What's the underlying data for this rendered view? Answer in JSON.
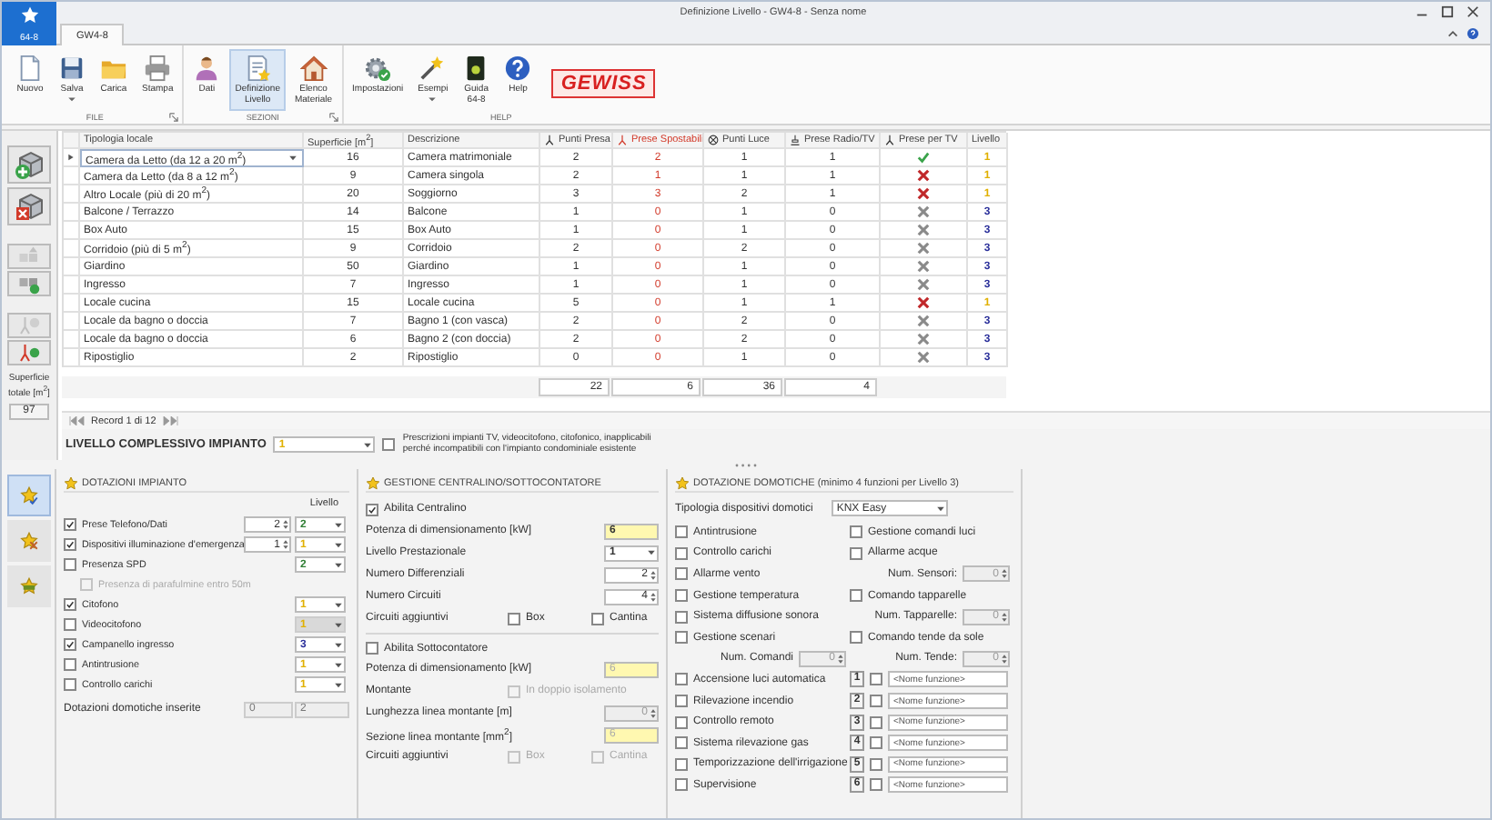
{
  "window": {
    "title": "Definizione Livello - GW4-8 - Senza nome"
  },
  "app_button": {
    "label": "64-8"
  },
  "tabs": [
    {
      "label": "GW4-8",
      "selected": true
    }
  ],
  "ribbon": [
    {
      "label": "FILE",
      "launcher": true,
      "buttons": [
        {
          "label": "Nuovo",
          "dropdown": false,
          "selected": false
        },
        {
          "label": "Salva",
          "dropdown": true,
          "selected": false
        },
        {
          "label": "Carica",
          "dropdown": false,
          "selected": false
        },
        {
          "label": "Stampa",
          "dropdown": false,
          "selected": false
        }
      ]
    },
    {
      "label": "SEZIONI",
      "launcher": true,
      "buttons": [
        {
          "label": "Dati",
          "dropdown": false,
          "selected": false
        },
        {
          "label": "Definizione Livello",
          "dropdown": false,
          "selected": true
        },
        {
          "label": "Elenco Materiale",
          "dropdown": false,
          "selected": false
        }
      ]
    },
    {
      "label": "HELP",
      "launcher": false,
      "logo": "GEWISS",
      "buttons": [
        {
          "label": "Impostazioni",
          "dropdown": false,
          "selected": false
        },
        {
          "label": "Esempi",
          "dropdown": true,
          "selected": false
        },
        {
          "label": "Guida 64-8",
          "dropdown": false,
          "selected": false
        },
        {
          "label": "Help",
          "dropdown": false,
          "selected": false
        }
      ]
    }
  ],
  "toolbar": [
    {
      "disabled": false
    },
    {
      "disabled": false
    },
    {
      "disabled": true
    },
    {
      "disabled": false
    },
    {
      "disabled": true
    },
    {
      "disabled": false
    }
  ],
  "surface_total": {
    "label": "Superficie totale [m$^{2}$]",
    "value": "97"
  },
  "table": {
    "columns": [
      {
        "label": "Tipologia locale"
      },
      {
        "label": "Superficie [m$^{2}$]"
      },
      {
        "label": "Descrizione"
      },
      {
        "label": "Punti Presa"
      },
      {
        "label": "Prese Spostabili"
      },
      {
        "label": "Punti Luce"
      },
      {
        "label": "Prese Radio/TV"
      },
      {
        "label": "Prese per TV"
      },
      {
        "label": "Livello"
      }
    ],
    "rows": [
      {
        "selected": true,
        "tipologia": "Camera da Letto (da 12 a 20 m$^{2}$)",
        "superficie": "16",
        "descrizione": "Camera matrimoniale",
        "punti_presa": "2",
        "prese_spostabili": "2",
        "punti_luce": "1",
        "prese_radio_tv": "1",
        "tv_applicable": true,
        "tv_ok": true,
        "livello": "1",
        "color": "#e0b000"
      },
      {
        "selected": false,
        "tipologia": "Camera da Letto (da 8 a 12 m$^{2}$)",
        "superficie": "9",
        "descrizione": "Camera singola",
        "punti_presa": "2",
        "prese_spostabili": "1",
        "punti_luce": "1",
        "prese_radio_tv": "1",
        "tv_applicable": true,
        "tv_ok": false,
        "livello": "1",
        "color": "#e0b000"
      },
      {
        "selected": false,
        "tipologia": "Altro Locale (più di 20 m$^{2}$)",
        "superficie": "20",
        "descrizione": "Soggiorno",
        "punti_presa": "3",
        "prese_spostabili": "3",
        "punti_luce": "2",
        "prese_radio_tv": "1",
        "tv_applicable": true,
        "tv_ok": false,
        "livello": "1",
        "color": "#e0b000"
      },
      {
        "selected": false,
        "tipologia": "Balcone / Terrazzo",
        "superficie": "14",
        "descrizione": "Balcone",
        "punti_presa": "1",
        "prese_spostabili": "0",
        "punti_luce": "1",
        "prese_radio_tv": "0",
        "tv_applicable": false,
        "livello": "3",
        "color": "#2a2f9a"
      },
      {
        "selected": false,
        "tipologia": "Box Auto",
        "superficie": "15",
        "descrizione": "Box Auto",
        "punti_presa": "1",
        "prese_spostabili": "0",
        "punti_luce": "1",
        "prese_radio_tv": "0",
        "tv_applicable": false,
        "livello": "3",
        "color": "#2a2f9a"
      },
      {
        "selected": false,
        "tipologia": "Corridoio (più di 5 m$^{2}$)",
        "superficie": "9",
        "descrizione": "Corridoio",
        "punti_presa": "2",
        "prese_spostabili": "0",
        "punti_luce": "2",
        "prese_radio_tv": "0",
        "tv_applicable": false,
        "livello": "3",
        "color": "#2a2f9a"
      },
      {
        "selected": false,
        "tipologia": "Giardino",
        "superficie": "50",
        "descrizione": "Giardino",
        "punti_presa": "1",
        "prese_spostabili": "0",
        "punti_luce": "1",
        "prese_radio_tv": "0",
        "tv_applicable": false,
        "livello": "3",
        "color": "#2a2f9a"
      },
      {
        "selected": false,
        "tipologia": "Ingresso",
        "superficie": "7",
        "descrizione": "Ingresso",
        "punti_presa": "1",
        "prese_spostabili": "0",
        "punti_luce": "1",
        "prese_radio_tv": "0",
        "tv_applicable": false,
        "livello": "3",
        "color": "#2a2f9a"
      },
      {
        "selected": false,
        "tipologia": "Locale cucina",
        "superficie": "15",
        "descrizione": "Locale cucina",
        "punti_presa": "5",
        "prese_spostabili": "0",
        "punti_luce": "1",
        "prese_radio_tv": "1",
        "tv_applicable": true,
        "tv_ok": false,
        "livello": "1",
        "color": "#e0b000"
      },
      {
        "selected": false,
        "tipologia": "Locale da bagno o doccia",
        "superficie": "7",
        "descrizione": "Bagno 1 (con vasca)",
        "punti_presa": "2",
        "prese_spostabili": "0",
        "punti_luce": "2",
        "prese_radio_tv": "0",
        "tv_applicable": false,
        "livello": "3",
        "color": "#2a2f9a"
      },
      {
        "selected": false,
        "tipologia": "Locale da bagno o doccia",
        "superficie": "6",
        "descrizione": "Bagno 2 (con doccia)",
        "punti_presa": "2",
        "prese_spostabili": "0",
        "punti_luce": "2",
        "prese_radio_tv": "0",
        "tv_applicable": false,
        "livello": "3",
        "color": "#2a2f9a"
      },
      {
        "selected": false,
        "tipologia": "Ripostiglio",
        "superficie": "2",
        "descrizione": "Ripostiglio",
        "punti_presa": "0",
        "prese_spostabili": "0",
        "punti_luce": "1",
        "prese_radio_tv": "0",
        "tv_applicable": false,
        "livello": "3",
        "color": "#2a2f9a"
      }
    ],
    "totals": [
      "22",
      "6",
      "36",
      "4"
    ]
  },
  "navigator": {
    "label": "Record 1 di 12"
  },
  "overall_level": {
    "label": "LIVELLO COMPLESSIVO IMPIANTO",
    "value": "1",
    "color": "#e0b000",
    "checked": false,
    "note": "Prescrizioni impianti TV, videocitofono, citofonico, inapplicabili perché incompatibili con l'impianto condominiale esistente"
  },
  "side_tabs": [
    {
      "selected": true
    },
    {
      "selected": false
    },
    {
      "selected": false
    }
  ],
  "dotazioni": {
    "title": "DOTAZIONI IMPIANTO",
    "level_header": "Livello",
    "items": [
      {
        "label": "Prese Telefono/Dati",
        "checked": true,
        "disabled": false,
        "spinner": "2",
        "livello": "2",
        "color": "#2e7d32",
        "livello_disabled": false
      },
      {
        "label": "Dispositivi illuminazione d'emergenza",
        "checked": true,
        "disabled": false,
        "spinner": "1",
        "livello": "1",
        "color": "#e0b000",
        "livello_disabled": false
      },
      {
        "label": "Presenza SPD",
        "checked": false,
        "disabled": false,
        "livello": "2",
        "color": "#2e7d32",
        "livello_disabled": false,
        "children": [
          {
            "label": "Presenza di parafulmine entro 50m",
            "checked": false,
            "disabled": true
          }
        ]
      },
      {
        "label": "Citofono",
        "checked": true,
        "disabled": false,
        "livello": "1",
        "color": "#e0b000",
        "livello_disabled": false
      },
      {
        "label": "Videocitofono",
        "checked": false,
        "disabled": false,
        "livello": "1",
        "color": "#e0b000",
        "livello_disabled": true
      },
      {
        "label": "Campanello ingresso",
        "checked": true,
        "disabled": false,
        "livello": "3",
        "color": "#2a2f9a",
        "livello_disabled": false
      },
      {
        "label": "Antintrusione",
        "checked": false,
        "disabled": false,
        "livello": "1",
        "color": "#e0b000",
        "livello_disabled": false
      },
      {
        "label": "Controllo carichi",
        "checked": false,
        "disabled": false,
        "livello": "1",
        "color": "#e0b000",
        "livello_disabled": false
      }
    ],
    "inserted": {
      "label": "Dotazioni domotiche inserite",
      "values": [
        "0",
        "2"
      ]
    }
  },
  "centralino": {
    "title": "GESTIONE CENTRALINO/SOTTOCONTATORE",
    "rows": [
      {
        "kind": "check",
        "label": "Abilita Centralino",
        "checked": true,
        "disabled": false
      },
      {
        "kind": "input",
        "label": "Potenza di dimensionamento [kW]",
        "value": "6",
        "disabled": false
      },
      {
        "kind": "combo",
        "label": "Livello Prestazionale",
        "value": "1",
        "disabled": false
      },
      {
        "kind": "spinner",
        "label": "Numero Differenziali",
        "value": "2",
        "disabled": false
      },
      {
        "kind": "spinner",
        "label": "Numero Circuiti",
        "value": "4",
        "disabled": false
      },
      {
        "kind": "options",
        "label": "Circuiti aggiuntivi",
        "disabled": false,
        "options": [
          {
            "label": "Box",
            "checked": false
          },
          {
            "label": "Cantina",
            "checked": false
          }
        ]
      },
      {
        "kind": "section",
        "label": "Abilita Sottocontatore",
        "checked": false,
        "disabled": false
      },
      {
        "kind": "input",
        "label": "Potenza di dimensionamento [kW]",
        "value": "6",
        "disabled": true
      },
      {
        "kind": "toggle",
        "label": "Montante",
        "disabled": true,
        "option": {
          "label": "In doppio isolamento",
          "checked": false
        }
      },
      {
        "kind": "spinner",
        "label": "Lunghezza linea montante [m]",
        "value": "0",
        "disabled": true
      },
      {
        "kind": "input",
        "label": "Sezione linea montante [mm$^{2}$]",
        "value": "6",
        "disabled": true
      },
      {
        "kind": "options",
        "label": "Circuiti aggiuntivi",
        "disabled": true,
        "options": [
          {
            "label": "Box",
            "checked": false
          },
          {
            "label": "Cantina",
            "checked": false
          }
        ]
      }
    ]
  },
  "domotica": {
    "title": "DOTAZIONE DOMOTICHE (minimo 4 funzioni per Livello 3)",
    "type_label": "Tipologia dispositivi domotici",
    "type_value": "KNX Easy",
    "left": [
      {
        "kind": "check",
        "label": "Antintrusione",
        "checked": false
      },
      {
        "kind": "check",
        "label": "Controllo carichi",
        "checked": false
      },
      {
        "kind": "check",
        "label": "Allarme vento",
        "checked": false
      },
      {
        "kind": "check",
        "label": "Gestione temperatura",
        "checked": false
      },
      {
        "kind": "check",
        "label": "Sistema diffusione sonora",
        "checked": false
      },
      {
        "kind": "check",
        "label": "Gestione scenari",
        "checked": false
      },
      {
        "kind": "spinner",
        "label": "Num. Comandi",
        "value": "0",
        "disabled": true
      },
      {
        "kind": "check",
        "label": "Accensione luci automatica",
        "checked": false
      },
      {
        "kind": "check",
        "label": "Rilevazione incendio",
        "checked": false
      },
      {
        "kind": "check",
        "label": "Controllo remoto",
        "checked": false
      },
      {
        "kind": "check",
        "label": "Sistema rilevazione gas",
        "checked": false
      },
      {
        "kind": "check",
        "label": "Temporizzazione dell'irrigazione",
        "checked": false
      },
      {
        "kind": "check",
        "label": "Supervisione",
        "checked": false
      }
    ],
    "right": [
      {
        "kind": "check",
        "label": "Gestione comandi luci",
        "checked": false
      },
      {
        "kind": "check",
        "label": "Allarme acque",
        "checked": false
      },
      {
        "kind": "spinner",
        "label": "Num. Sensori:",
        "value": "0",
        "disabled": true
      },
      {
        "kind": "check",
        "label": "Comando tapparelle",
        "checked": false
      },
      {
        "kind": "spinner",
        "label": "Num. Tapparelle:",
        "value": "0",
        "disabled": true
      },
      {
        "kind": "check",
        "label": "Comando tende da sole",
        "checked": false
      },
      {
        "kind": "spinner",
        "label": "Num. Tende:",
        "value": "0",
        "disabled": true
      },
      {
        "kind": "custom",
        "number": "1",
        "checked": false,
        "placeholder": "<Nome funzione>"
      },
      {
        "kind": "custom",
        "number": "2",
        "checked": false,
        "placeholder": "<Nome funzione>"
      },
      {
        "kind": "custom",
        "number": "3",
        "checked": false,
        "placeholder": "<Nome funzione>"
      },
      {
        "kind": "custom",
        "number": "4",
        "checked": false,
        "placeholder": "<Nome funzione>"
      },
      {
        "kind": "custom",
        "number": "5",
        "checked": false,
        "placeholder": "<Nome funzione>"
      },
      {
        "kind": "custom",
        "number": "6",
        "checked": false,
        "placeholder": "<Nome funzione>"
      }
    ]
  }
}
